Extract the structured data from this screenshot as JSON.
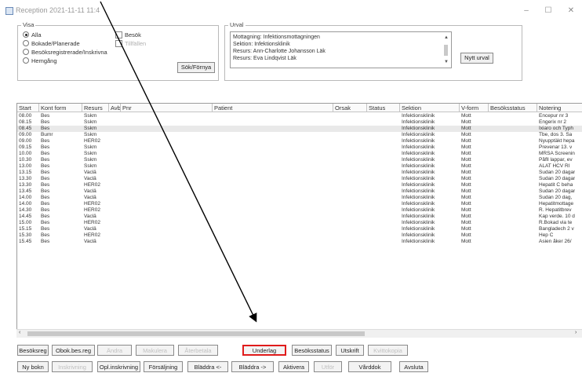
{
  "window": {
    "title": "Reception 2021-11-11 11:4",
    "minimize": "–",
    "maximize": "☐",
    "close": "✕"
  },
  "visa": {
    "label": "Visa",
    "options": [
      "Alla",
      "Bokade/Planerade",
      "Besöksregistrerade/Inskrivna",
      "Hemgång"
    ],
    "selected_index": 0,
    "right_options": [
      "Besök",
      "Tillfällen"
    ],
    "sok_button": "Sök/Förnya"
  },
  "urval": {
    "label": "Urval",
    "lines": [
      "Mottagning: Infektionsmottagningen",
      "Sektion: Infektionsklinik",
      "Resurs: Ann-Charlotte Johansson Läk",
      "Resurs: Eva Lindqvist Läk"
    ],
    "nytt_button": "Nytt urval"
  },
  "table": {
    "columns": [
      "Start",
      "Kont form",
      "Resurs",
      "Avb",
      "Pnr",
      "Patient",
      "Orsak",
      "Status",
      "Sektion",
      "V-form",
      "Besöksstatus",
      "Notering"
    ],
    "rows": [
      [
        "08.00",
        "Bes",
        "Sskm",
        "Infektionsklinik",
        "Mott",
        "Encepur nr 3"
      ],
      [
        "08.15",
        "Bes",
        "Sskm",
        "Infektionsklinik",
        "Mott",
        "Engerix nr 2"
      ],
      [
        "08.45",
        "Bes",
        "Sskm",
        "Infektionsklinik",
        "Mott",
        "Ixiaro och Typh"
      ],
      [
        "09.00",
        "Bumr",
        "Sskm",
        "Infektionsklinik",
        "Mott",
        "Tbe, dos 3. Sa"
      ],
      [
        "09.00",
        "Bes",
        "HER02",
        "Infektionsklinik",
        "Mott",
        "Nyupptäkt hepa"
      ],
      [
        "09.15",
        "Bes",
        "Sskm",
        "Infektionsklinik",
        "Mott",
        "Prevenar 13. v"
      ],
      [
        "10.00",
        "Bes",
        "Sskm",
        "Infektionsklinik",
        "Mott",
        "MRSA Screenin"
      ],
      [
        "10.30",
        "Bes",
        "Sskm",
        "Infektionsklinik",
        "Mott",
        "Påfll lappar, ev"
      ],
      [
        "13.00",
        "Bes",
        "Sskm",
        "Infektionsklinik",
        "Mott",
        "ALAT  HCV RI"
      ],
      [
        "13.15",
        "Bes",
        "Vaclä",
        "Infektionsklinik",
        "Mott",
        "Sudan 20 dagar"
      ],
      [
        "13.30",
        "Bes",
        "Vaclä",
        "Infektionsklinik",
        "Mott",
        "Sudan 20 dagar"
      ],
      [
        "13.30",
        "Bes",
        "HER02",
        "Infektionsklinik",
        "Mott",
        "Hepatit C beha"
      ],
      [
        "13.45",
        "Bes",
        "Vaclä",
        "Infektionsklinik",
        "Mott",
        "Sudan 20 dagar"
      ],
      [
        "14.00",
        "Bes",
        "Vaclä",
        "Infektionsklinik",
        "Mott",
        "Sudan 20 dag,"
      ],
      [
        "14.00",
        "Bes",
        "HER02",
        "Infektionsklinik",
        "Mott",
        "Hepatitmottage"
      ],
      [
        "14.30",
        "Bes",
        "HER02",
        "Infektionsklinik",
        "Mott",
        "R. Hepatitbrev"
      ],
      [
        "14.45",
        "Bes",
        "Vaclä",
        "Infektionsklinik",
        "Mott",
        "Kap verde. 10 d"
      ],
      [
        "15.00",
        "Bes",
        "HER02",
        "Infektionsklinik",
        "Mott",
        "R.Bokad via te"
      ],
      [
        "15.15",
        "Bes",
        "Vaclä",
        "Infektionsklinik",
        "Mott",
        "Bangladech 2 v"
      ],
      [
        "15.30",
        "Bes",
        "HER02",
        "Infektionsklinik",
        "Mott",
        "Hep C"
      ],
      [
        "15.45",
        "Bes",
        "Vaclä",
        "Infektionsklinik",
        "Mott",
        "Asien åker 26/"
      ]
    ],
    "selected_row": 2
  },
  "buttons_row1": [
    {
      "label": "Besöksreg",
      "enabled": true
    },
    {
      "label": "Obok.bes.reg",
      "enabled": true
    },
    {
      "label": "Ändra",
      "enabled": false
    },
    {
      "label": "Makulera",
      "enabled": false
    },
    {
      "label": "Återbetala",
      "enabled": false
    },
    {
      "label": "Underlag",
      "enabled": true,
      "highlight": true
    },
    {
      "label": "Besöksstatus",
      "enabled": true
    },
    {
      "label": "Utskrift",
      "enabled": true
    },
    {
      "label": "Kvittokopia",
      "enabled": false
    }
  ],
  "buttons_row2": [
    {
      "label": "Ny bokn",
      "enabled": true
    },
    {
      "label": "Inskrivning",
      "enabled": false
    },
    {
      "label": "Opl.inskrivning",
      "enabled": true
    },
    {
      "label": "Försäljning",
      "enabled": true
    },
    {
      "label": "Bläddra <-",
      "enabled": true
    },
    {
      "label": "Bläddra ->",
      "enabled": true
    },
    {
      "label": "Aktivera",
      "enabled": true
    },
    {
      "label": "Utför",
      "enabled": false
    },
    {
      "label": "Vårddok",
      "enabled": true
    },
    {
      "label": "Avsluta",
      "enabled": true
    }
  ],
  "colors": {
    "highlight": "#e01b1b",
    "arrow": "#000000"
  }
}
